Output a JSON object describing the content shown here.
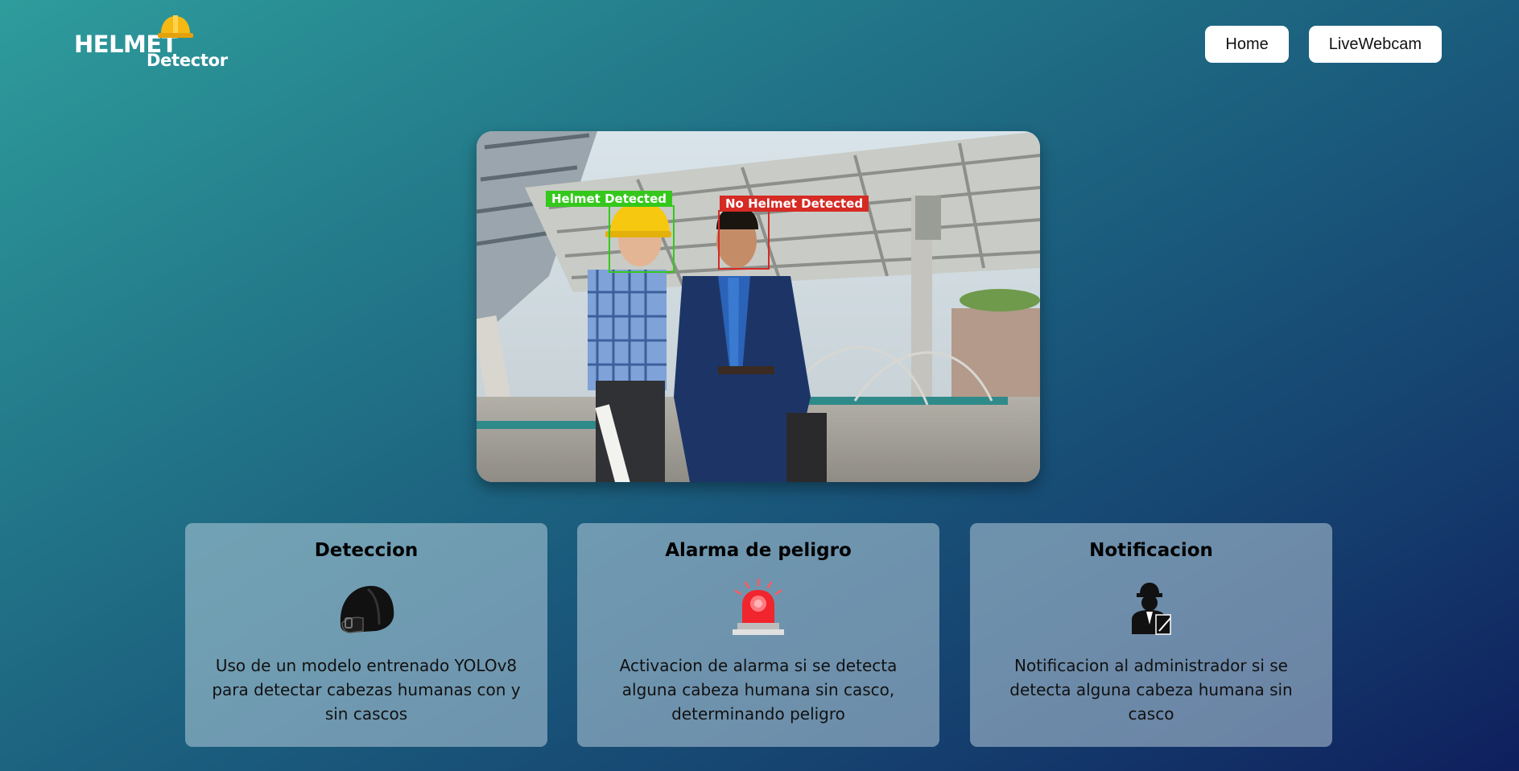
{
  "header": {
    "logo_word1": "HELMET",
    "logo_word2": "Detector",
    "nav": [
      {
        "label": "Home"
      },
      {
        "label": "LiveWebcam"
      }
    ]
  },
  "hero": {
    "detections": [
      {
        "label": "Helmet Detected",
        "status_color": "#35c81c"
      },
      {
        "label": "No Helmet Detected",
        "status_color": "#d62a24"
      }
    ]
  },
  "cards": [
    {
      "title": "Deteccion",
      "icon": "helmet-icon",
      "text": "Uso de un modelo entrenado YOLOv8 para detectar cabezas humanas con y sin cascos"
    },
    {
      "title": "Alarma de peligro",
      "icon": "siren-icon",
      "text": "Activacion de alarma si se detecta alguna cabeza humana sin casco, determinando peligro"
    },
    {
      "title": "Notificacion",
      "icon": "worker-icon",
      "text": "Notificacion al administrador si se detecta alguna cabeza humana sin casco"
    }
  ],
  "colors": {
    "accent_ok": "#35c81c",
    "accent_bad": "#d62a24",
    "helmet_yellow": "#f6b913"
  }
}
